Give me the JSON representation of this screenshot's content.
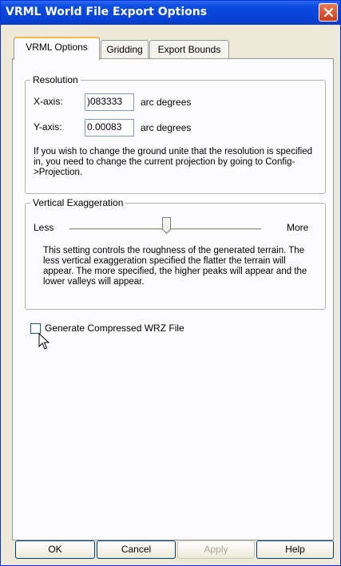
{
  "window": {
    "title": "VRML World File Export Options"
  },
  "icons": {
    "close": "close-icon",
    "cursor": "mouse-pointer-icon"
  },
  "tabs": [
    {
      "label": "VRML Options",
      "active": true
    },
    {
      "label": "Gridding",
      "active": false
    },
    {
      "label": "Export Bounds",
      "active": false
    }
  ],
  "resolution": {
    "legend": "Resolution",
    "x_label": "X-axis:",
    "x_value": ")083333",
    "x_unit": "arc degrees",
    "y_label": "Y-axis:",
    "y_value": "0.00083",
    "y_unit": "arc degrees",
    "note": "If you wish to change the ground unite that the resolution is specified in, you need to change the current projection by going to Config->Projection."
  },
  "vertical_exaggeration": {
    "legend": "Vertical Exaggeration",
    "less_label": "Less",
    "more_label": "More",
    "slider_fraction": 0.5,
    "description": "This setting controls the roughness of the generated terrain. The less vertical exaggeration specified the flatter the terrain will appear. The more specified, the higher peaks will appear and the lower valleys will appear."
  },
  "compressed_checkbox": {
    "label": "Generate Compressed WRZ File",
    "checked": false
  },
  "buttons": {
    "ok": "OK",
    "cancel": "Cancel",
    "apply": "Apply",
    "help": "Help"
  },
  "colors": {
    "titlebar": "#0a4be0",
    "face": "#ece9d8",
    "panel": "#fcfcfe",
    "tab_highlight": "#f6b84a"
  }
}
